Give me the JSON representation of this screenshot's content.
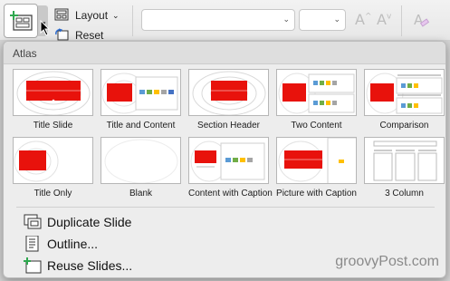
{
  "ribbon": {
    "layout_label": "Layout",
    "reset_label": "Reset",
    "font_name_value": "",
    "font_size_value": ""
  },
  "gallery": {
    "section_title": "Atlas",
    "layouts": [
      {
        "label": "Title Slide"
      },
      {
        "label": "Title and Content"
      },
      {
        "label": "Section Header"
      },
      {
        "label": "Two Content"
      },
      {
        "label": "Comparison"
      },
      {
        "label": "Title Only"
      },
      {
        "label": "Blank"
      },
      {
        "label": "Content with Caption"
      },
      {
        "label": "Picture with Caption"
      },
      {
        "label": "3 Column"
      }
    ]
  },
  "menu": {
    "duplicate_label": "Duplicate Slide",
    "outline_label": "Outline...",
    "reuse_label": "Reuse Slides..."
  },
  "watermark": "groovyPost.com",
  "colors": {
    "accent_red": "#e8120c",
    "plus_green": "#2fa84f"
  }
}
